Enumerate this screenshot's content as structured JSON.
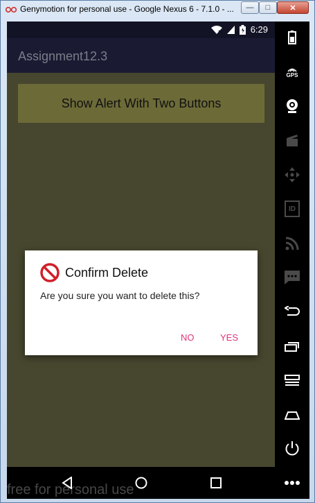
{
  "window": {
    "title": "Genymotion for personal use - Google Nexus 6 - 7.1.0 - ...",
    "minimize_glyph": "—",
    "maximize_glyph": "□",
    "close_glyph": "✕"
  },
  "statusbar": {
    "time": "6:29"
  },
  "appbar": {
    "title": "Assignment12.3"
  },
  "main": {
    "show_alert_button": "Show Alert With Two Buttons"
  },
  "dialog": {
    "icon": "no-entry-icon",
    "title": "Confirm Delete",
    "message": "Are you sure you want to delete this?",
    "negative_label": "NO",
    "positive_label": "YES",
    "accent_color": "#e0337a"
  },
  "sidepanel": {
    "gps_label": "GPS",
    "id_label": "ID",
    "icons": [
      "battery-icon",
      "gps-icon",
      "webcam-icon",
      "clapper-icon",
      "dpad-icon",
      "id-icon",
      "rss-icon",
      "sms-icon",
      "back-icon",
      "recent-apps-icon",
      "menu-icon",
      "home-icon",
      "power-icon",
      "more-icon"
    ]
  },
  "watermark": "free for personal use"
}
